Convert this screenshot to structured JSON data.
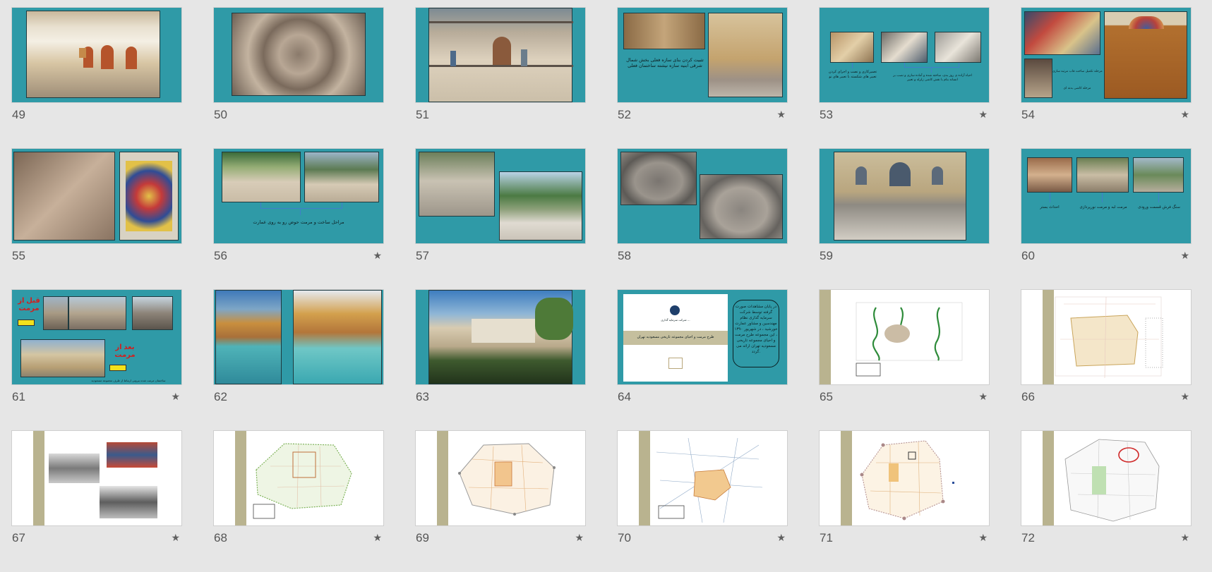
{
  "colors": {
    "background": "#e6e6e6",
    "teal_slide": "#2f9aa7",
    "sidebar_band": "#b9b38f",
    "number_text": "#555555",
    "star": "#606060"
  },
  "slides": [
    {
      "num": "49",
      "star": false
    },
    {
      "num": "50",
      "star": false
    },
    {
      "num": "51",
      "star": false
    },
    {
      "num": "52",
      "star": true,
      "caption": "تثبیت کردن بنای سازه فعلی بخش شمال شرقی ابنیه سازه نیشته ساختمان فعلی"
    },
    {
      "num": "53",
      "star": true,
      "caption_left": "تعمیرکاری و نصب و اجرای کردن تعبیر های شکسته با تعبیر های نو",
      "caption_right": "احیاء آزاده ی روز بدی، ساخته شده و آماده سازی و نصب بر انسانه بنام با نقش کاشی زلزله و تعبیر"
    },
    {
      "num": "54",
      "star": true,
      "caption_top": "مرحله تکمیل ساخت قاب مرتبه سازی",
      "caption_bottom": "مرحله کاشی بدنه ای"
    },
    {
      "num": "55",
      "star": false
    },
    {
      "num": "56",
      "star": true,
      "caption": "مراحل ساخت و مرمت حوض رو به روی عمارت"
    },
    {
      "num": "57",
      "star": false
    },
    {
      "num": "58",
      "star": false
    },
    {
      "num": "59",
      "star": false
    },
    {
      "num": "60",
      "star": true,
      "captions": [
        "سنگ فرش قسمت ورودی",
        "مرمت لبه و مرمت نورپردازی",
        "احداث بستر"
      ]
    },
    {
      "num": "61",
      "star": true,
      "before": "قبل از مرمت",
      "after": "بعد از مرمت",
      "caption": "ساختمان مرمت شده بیرونی ارتباط از طرف مجموعه مسعودیه"
    },
    {
      "num": "62",
      "star": false
    },
    {
      "num": "63",
      "star": false
    },
    {
      "num": "64",
      "star": false,
      "company": "شرکت سرمایه گذاری ...",
      "title": "طرح مرمت و احیای مجموعه تاریخی مسعودیه تهران",
      "oval_text": "در پایان مشاهدات صورت گرفته توسط شرکت سرمایه گذاری نظام مهندسین و مشاور عمارت خورشید ، در شهریور ۱۳۹۰ ، این مجموعه طرح مرمت و احیای مجموعه تاریخی مسعودیه تهران ارائه می گردد."
    },
    {
      "num": "65",
      "star": true
    },
    {
      "num": "66",
      "star": true
    },
    {
      "num": "67",
      "star": true
    },
    {
      "num": "68",
      "star": true
    },
    {
      "num": "69",
      "star": true
    },
    {
      "num": "70",
      "star": true
    },
    {
      "num": "71",
      "star": true
    },
    {
      "num": "72",
      "star": true
    }
  ],
  "icons": {
    "star": "★"
  }
}
